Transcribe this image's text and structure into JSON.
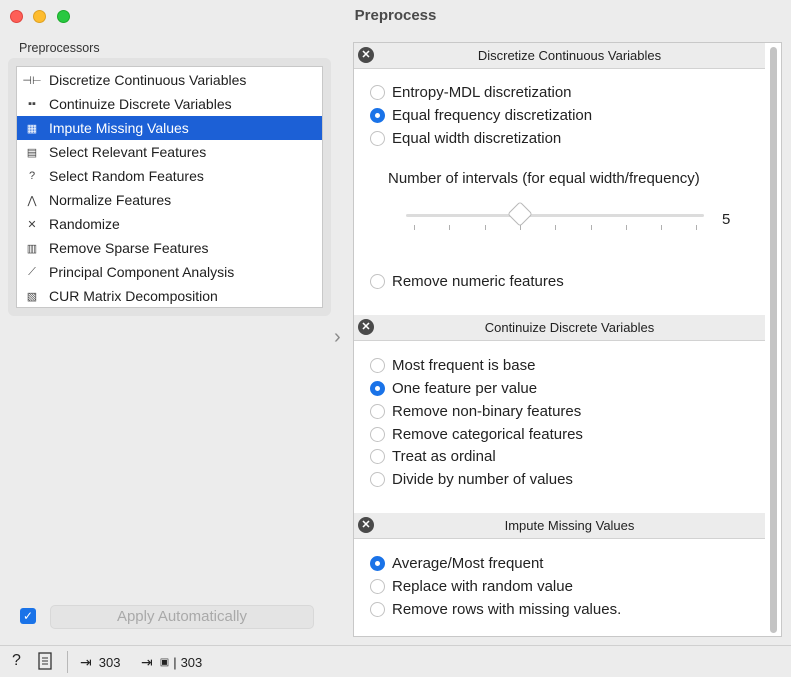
{
  "window": {
    "title": "Preprocess"
  },
  "left": {
    "label": "Preprocessors",
    "items": [
      {
        "label": "Discretize Continuous Variables",
        "icon": "discretize-icon",
        "glyph": "⊣⊢"
      },
      {
        "label": "Continuize Discrete Variables",
        "icon": "continuize-icon",
        "glyph": "▪▪"
      },
      {
        "label": "Impute Missing Values",
        "icon": "impute-icon",
        "glyph": "▦"
      },
      {
        "label": "Select Relevant Features",
        "icon": "select-relevant-icon",
        "glyph": "▤"
      },
      {
        "label": "Select Random Features",
        "icon": "select-random-icon",
        "glyph": "?"
      },
      {
        "label": "Normalize Features",
        "icon": "normalize-icon",
        "glyph": "⋀"
      },
      {
        "label": "Randomize",
        "icon": "randomize-icon",
        "glyph": "✕"
      },
      {
        "label": "Remove Sparse Features",
        "icon": "remove-sparse-icon",
        "glyph": "▥"
      },
      {
        "label": "Principal Component Analysis",
        "icon": "pca-icon",
        "glyph": "⟋"
      },
      {
        "label": "CUR Matrix Decomposition",
        "icon": "cur-icon",
        "glyph": "▧"
      }
    ],
    "selected_item": "Impute Missing Values",
    "apply_automatically": {
      "label": "Apply Automatically",
      "checked": true
    }
  },
  "right": {
    "discretize": {
      "title": "Discretize Continuous Variables",
      "options": [
        "Entropy-MDL discretization",
        "Equal frequency discretization",
        "Equal width discretization"
      ],
      "selected": "Equal frequency discretization",
      "intervals_label": "Number of intervals (for equal width/frequency)",
      "intervals_value": "5",
      "remove_numeric": "Remove numeric features"
    },
    "continuize": {
      "title": "Continuize Discrete Variables",
      "options": [
        "Most frequent is base",
        "One feature per value",
        "Remove non-binary features",
        "Remove categorical features",
        "Treat as ordinal",
        "Divide by number of values"
      ],
      "selected": "One feature per value"
    },
    "impute": {
      "title": "Impute Missing Values",
      "options": [
        "Average/Most frequent",
        "Replace with random value",
        "Remove rows with missing values."
      ],
      "selected": "Average/Most frequent"
    }
  },
  "status": {
    "input_count": "303",
    "output_count": "303"
  },
  "colors": {
    "accent": "#1a73e8",
    "selection": "#1c60d6"
  }
}
